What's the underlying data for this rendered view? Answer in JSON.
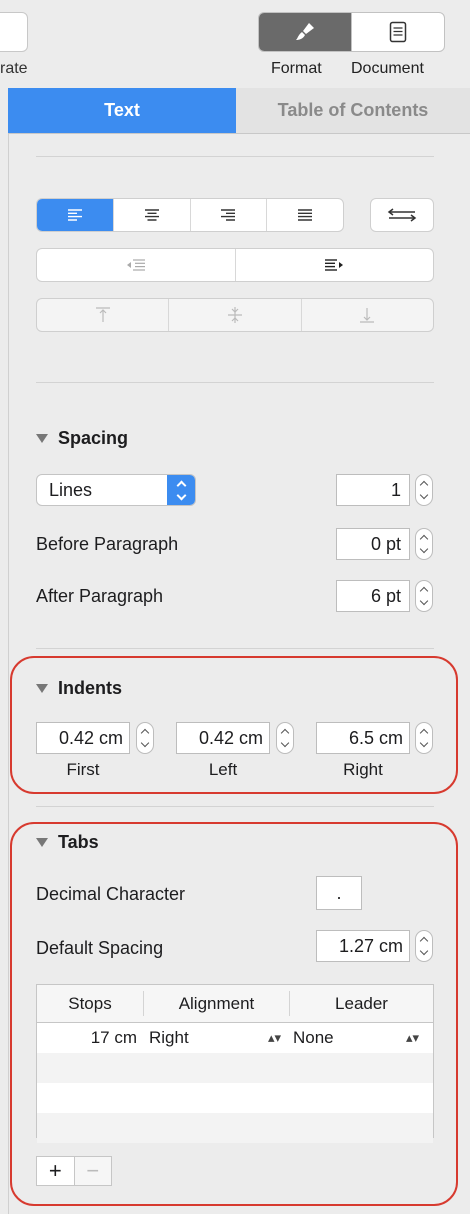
{
  "toolbar": {
    "truncated_label": "rate",
    "format_label": "Format",
    "document_label": "Document"
  },
  "tabs": [
    "Text",
    "Table of Contents"
  ],
  "spacing": {
    "title": "Spacing",
    "mode": "Lines",
    "line_value": "1",
    "before_label": "Before Paragraph",
    "before_value": "0 pt",
    "after_label": "After Paragraph",
    "after_value": "6 pt"
  },
  "indents": {
    "title": "Indents",
    "first_value": "0.42 cm",
    "first_label": "First",
    "left_value": "0.42 cm",
    "left_label": "Left",
    "right_value": "6.5 cm",
    "right_label": "Right"
  },
  "tabs_section": {
    "title": "Tabs",
    "decimal_label": "Decimal Character",
    "decimal_value": ".",
    "default_label": "Default Spacing",
    "default_value": "1.27 cm",
    "columns": [
      "Stops",
      "Alignment",
      "Leader"
    ],
    "rows": [
      {
        "stop": "17 cm",
        "alignment": "Right",
        "leader": "None"
      }
    ],
    "add": "+",
    "remove": "−"
  },
  "colors": {
    "accent": "#3c8cf0",
    "highlight": "#d73a2f"
  },
  "icons": {
    "format": "paintbrush-icon",
    "document": "document-icon"
  }
}
